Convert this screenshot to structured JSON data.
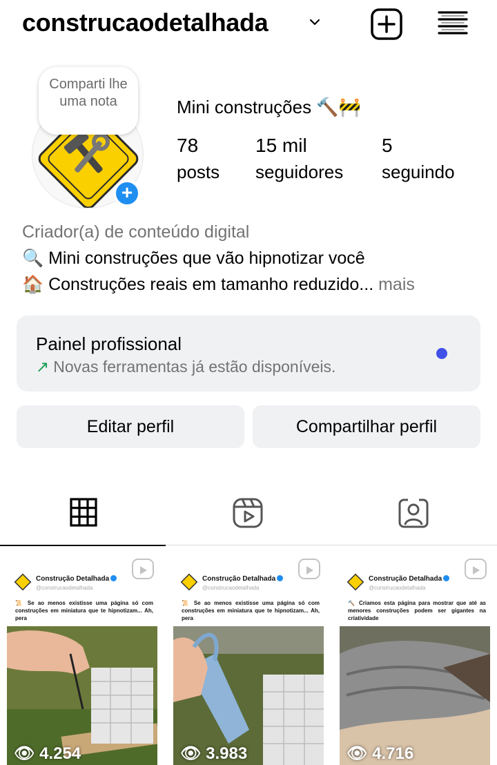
{
  "header": {
    "username": "construcaodetalhada"
  },
  "profile": {
    "note": "Comparti lhe uma nota",
    "display_name": "Mini construções 🔨🚧",
    "stats": [
      {
        "number": "78",
        "label": "posts"
      },
      {
        "number": "15 mil",
        "label": "seguidores"
      },
      {
        "number": "5",
        "label": "seguindo"
      }
    ],
    "category": "Criador(a) de conteúdo digital",
    "bio_line1": "🔍 Mini construções que vão hipnotizar você",
    "bio_line2": "🏠 Construções reais em tamanho reduzido...",
    "bio_more": "mais"
  },
  "pro_panel": {
    "title": "Painel profissional",
    "subtitle": "Novas ferramentas já estão disponíveis.",
    "arrow": "↗"
  },
  "buttons": {
    "edit": "Editar perfil",
    "share": "Compartilhar perfil"
  },
  "posts": [
    {
      "brand": "Construção Detalhada",
      "handle": "@construcaodetalhada",
      "caption": "📜 Se ao menos existisse uma página só com construções em miniatura que te hipnotizam... Ah, pera",
      "views": "4.254"
    },
    {
      "brand": "Construção Detalhada",
      "handle": "@construcaodetalhada",
      "caption": "📜 Se ao menos existisse uma página só com construções em miniatura que te hipnotizam... Ah, pera",
      "views": "3.983"
    },
    {
      "brand": "Construção Detalhada",
      "handle": "@construcaodetalhada",
      "caption": "🔨 Criamos esta página para mostrar que até as menores construções podem ser gigantes na criatividade",
      "views": "4.716"
    }
  ],
  "colors": {
    "accent_blue": "#1f8ef1",
    "panel_bg": "#eff1f3",
    "dot": "#4051e8",
    "green_arrow": "#1a9b52"
  }
}
